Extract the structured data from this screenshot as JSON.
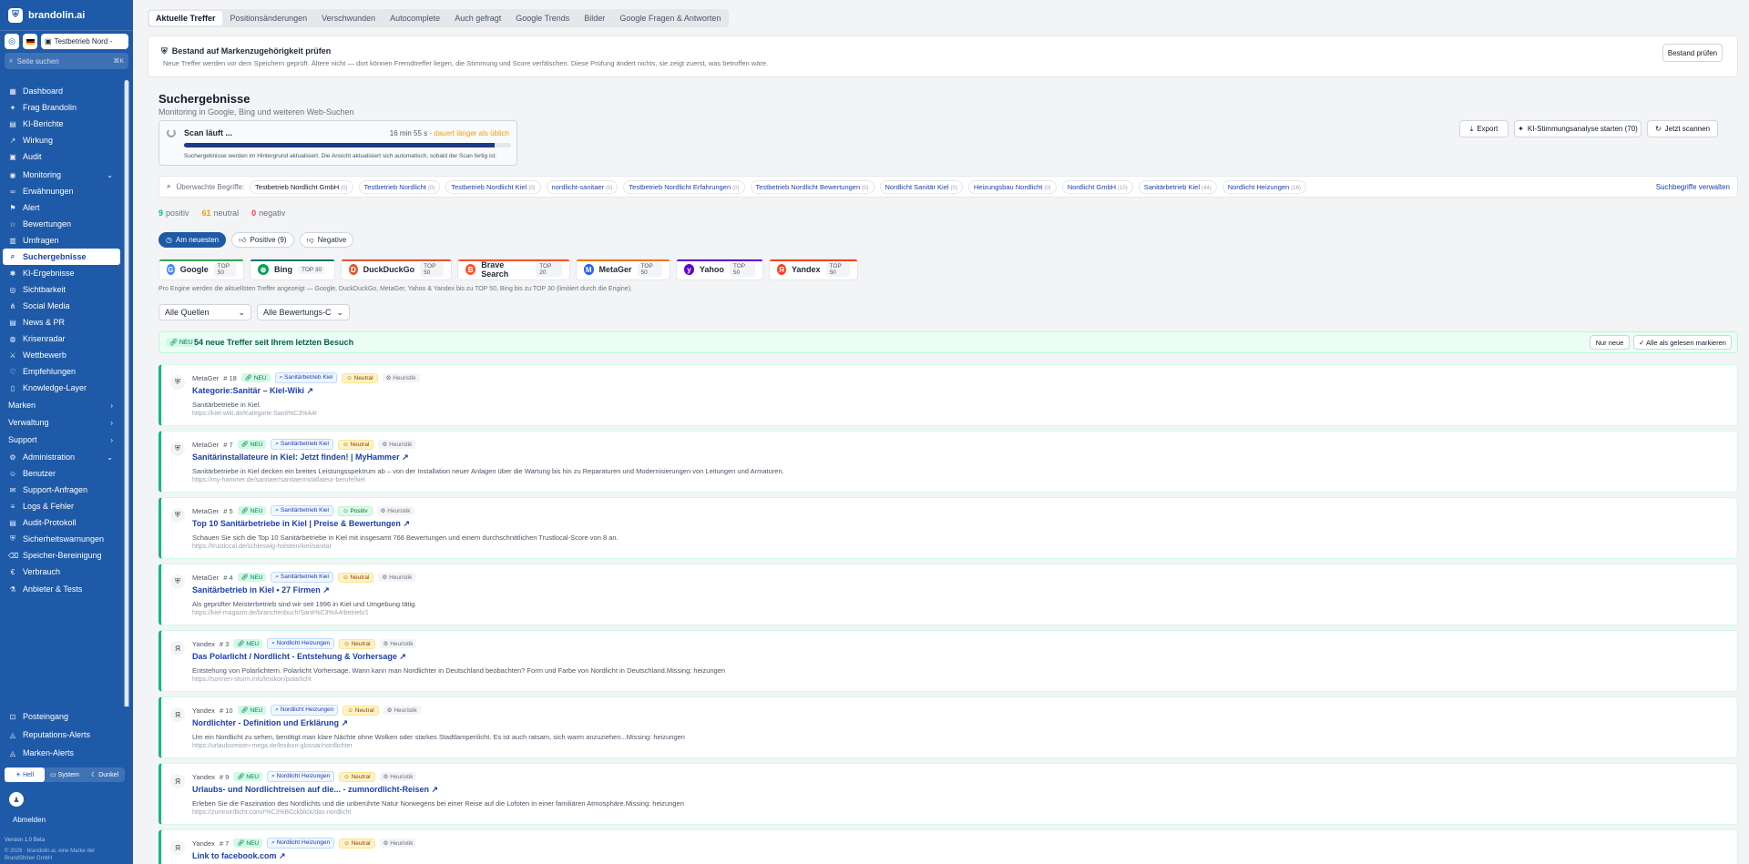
{
  "brand": {
    "name": "brandolin.ai"
  },
  "context": {
    "company": "Testbetrieb Nord -"
  },
  "search": {
    "placeholder": "Seite suchen",
    "shortcut": "⌘K"
  },
  "nav": {
    "items": [
      {
        "label": "Dashboard",
        "icon": "dashboard-icon"
      },
      {
        "label": "Frag Brandolin",
        "icon": "sparkle-icon"
      },
      {
        "label": "KI-Berichte",
        "icon": "report-icon"
      },
      {
        "label": "Wirkung",
        "icon": "trend-icon"
      },
      {
        "label": "Audit",
        "icon": "audit-icon"
      },
      {
        "label": "Monitoring",
        "icon": "monitor-icon",
        "chevron": "down"
      },
      {
        "label": "Erwähnungen",
        "icon": "link-icon"
      },
      {
        "label": "Alert",
        "icon": "alert-icon"
      },
      {
        "label": "Bewertungen",
        "icon": "star-icon"
      },
      {
        "label": "Umfragen",
        "icon": "survey-icon"
      },
      {
        "label": "Suchergebnisse",
        "icon": "search-icon",
        "active": true
      },
      {
        "label": "KI-Ergebnisse",
        "icon": "ai-icon"
      },
      {
        "label": "Sichtbarkeit",
        "icon": "eye-icon"
      },
      {
        "label": "Social Media",
        "icon": "share-icon"
      },
      {
        "label": "News & PR",
        "icon": "news-icon"
      },
      {
        "label": "Krisenradar",
        "icon": "radar-icon"
      },
      {
        "label": "Wettbewerb",
        "icon": "compete-icon"
      },
      {
        "label": "Empfehlungen",
        "icon": "recommend-icon"
      },
      {
        "label": "Knowledge-Layer",
        "icon": "book-icon"
      },
      {
        "label": "Marken",
        "icon": "",
        "chevron": "right"
      },
      {
        "label": "Verwaltung",
        "icon": "",
        "chevron": "right"
      },
      {
        "label": "Support",
        "icon": "",
        "chevron": "right"
      },
      {
        "label": "Administration",
        "icon": "admin-icon",
        "chevron": "down"
      },
      {
        "label": "Benutzer",
        "icon": "user-icon"
      },
      {
        "label": "Support-Anfragen",
        "icon": "chat-icon"
      },
      {
        "label": "Logs & Fehler",
        "icon": "log-icon"
      },
      {
        "label": "Audit-Protokoll",
        "icon": "protocol-icon"
      },
      {
        "label": "Sicherheitswarnungen",
        "icon": "shield-icon"
      },
      {
        "label": "Speicher-Bereinigung",
        "icon": "trash-icon"
      },
      {
        "label": "Verbrauch",
        "icon": "euro-icon"
      },
      {
        "label": "Anbieter & Tests",
        "icon": "test-icon"
      }
    ]
  },
  "nav_footer": {
    "items": [
      {
        "label": "Posteingang",
        "icon": "inbox-icon"
      },
      {
        "label": "Reputations-Alerts",
        "icon": "bell-icon"
      },
      {
        "label": "Marken-Alerts",
        "icon": "bell-icon"
      }
    ]
  },
  "theme": {
    "light": "Hell",
    "system": "System",
    "dark": "Dunkel"
  },
  "user": {
    "logout": "Abmelden"
  },
  "footer": {
    "version": "Version 1.0 Beta",
    "copyright": "© 2026 · brandolin.ai, eine Marke der BrandShiner GmbH"
  },
  "tabs": [
    "Aktuelle Treffer",
    "Positionsänderungen",
    "Verschwunden",
    "Autocomplete",
    "Auch gefragt",
    "Google Trends",
    "Bilder",
    "Google Fragen & Antworten"
  ],
  "banner": {
    "title": "Bestand auf Markenzugehörigkeit prüfen",
    "desc": "Neue Treffer werden vor dem Speichern geprüft. Ältere nicht — dort können Fremdtreffer liegen, die Stimmung und Score verfälschen. Diese Prüfung ändert nichts, sie zeigt zuerst, was betroffen wäre.",
    "button": "Bestand prüfen"
  },
  "page": {
    "title": "Suchergebnisse",
    "subtitle": "Monitoring in Google, Bing und weiteren Web-Suchen"
  },
  "actions": {
    "export": "Export",
    "ai": "KI-Stimmungsanalyse starten (70)",
    "scan": "Jetzt scannen"
  },
  "scan": {
    "title": "Scan läuft ...",
    "time": "16 min 55 s ·",
    "warn": "dauert länger als üblich",
    "progress": 0.95,
    "note": "Suchergebnisse werden im Hintergrund aktualisiert. Die Ansicht aktualisiert sich automatisch, sobald der Scan fertig ist."
  },
  "terms": {
    "label": "Überwachte Begriffe:",
    "manage": "Suchbegriffe verwalten",
    "items": [
      {
        "name": "Testbetrieb Nordlicht GmbH",
        "count": "(0)"
      },
      {
        "name": "Testbetrieb Nordlicht",
        "count": "(0)"
      },
      {
        "name": "Testbetrieb Nordlicht Kiel",
        "count": "(0)"
      },
      {
        "name": "nordlicht-sanitaer",
        "count": "(0)"
      },
      {
        "name": "Testbetrieb Nordlicht Erfahrungen",
        "count": "(0)"
      },
      {
        "name": "Testbetrieb Nordlicht Bewertungen",
        "count": "(0)"
      },
      {
        "name": "Nordlicht Sanitär Kiel",
        "count": "(0)"
      },
      {
        "name": "Heizungsbau Nordlicht",
        "count": "(0)"
      },
      {
        "name": "Nordlicht GmbH",
        "count": "(10)"
      },
      {
        "name": "Sanitärbetrieb Kiel",
        "count": "(44)"
      },
      {
        "name": "Nordlicht Heizungen",
        "count": "(16)"
      }
    ]
  },
  "stats": {
    "pos": "9",
    "pos_label": "positiv",
    "neu": "61",
    "neu_label": "neutral",
    "neg": "0",
    "neg_label": "negativ"
  },
  "filters": [
    "Am neuesten",
    "Positive (9)",
    "Negative"
  ],
  "engines": [
    {
      "name": "Google",
      "top": "TOP 50",
      "color": "#4285f4",
      "glyph": "G",
      "line": "#34a853"
    },
    {
      "name": "Bing",
      "top": "TOP 30",
      "color": "#0f9d58",
      "glyph": "⊕",
      "line": "#0f766e"
    },
    {
      "name": "DuckDuckGo",
      "top": "TOP 50",
      "color": "#de5833",
      "glyph": "D",
      "line": "#de5833"
    },
    {
      "name": "Brave Search",
      "top": "TOP 20",
      "color": "#fb542b",
      "glyph": "B",
      "line": "#fb542b"
    },
    {
      "name": "MetaGer",
      "top": "TOP 50",
      "color": "#2563eb",
      "glyph": "M",
      "line": "#f97316"
    },
    {
      "name": "Yahoo",
      "top": "TOP 50",
      "color": "#6001d2",
      "glyph": "y",
      "line": "#6001d2"
    },
    {
      "name": "Yandex",
      "top": "TOP 50",
      "color": "#fc3f1d",
      "glyph": "Я",
      "line": "#fc3f1d"
    }
  ],
  "engine_note": "Pro Engine werden die aktuellsten Treffer angezeigt — Google, DuckDuckGo, MetaGer, Yahoo & Yandex bis zu TOP 50, Bing bis zu TOP 30 (limitiert durch die Engine).",
  "dropdowns": {
    "sources": "Alle Quellen",
    "ratings": "Alle Bewertungs-C"
  },
  "newbar": {
    "badge": "NEU",
    "text": "54 neue Treffer seit Ihrem letzten Besuch",
    "only_new": "Nur neue",
    "mark_all": "✓ Alle als gelesen markieren"
  },
  "results": [
    {
      "engine": "MetaGer",
      "rank": "# 18",
      "new": "NEU",
      "term": "Sanitärbetrieb Kiel",
      "sentiment": "Neutral",
      "method": "Heuristik",
      "title": "Kategorie:Sanitär – Kiel-Wiki",
      "desc": "Sanitärbetriebe in Kiel.",
      "url": "https://kiel-wiki.de/Kategorie:Sanit%C3%A4r"
    },
    {
      "engine": "MetaGer",
      "rank": "# 7",
      "new": "NEU",
      "term": "Sanitärbetrieb Kiel",
      "sentiment": "Neutral",
      "method": "Heuristik",
      "title": "Sanitärinstallateure in Kiel: Jetzt finden! | MyHammer",
      "desc": "Sanitärbetriebe in Kiel decken ein breites Leistungsspektrum ab – von der Installation neuer Anlagen über die Wartung bis hin zu Reparaturen und Modernisierungen von Leitungen und Armaturen.",
      "url": "https://my-hammer.de/sanitaer/sanitaerinstallateur-berufe/kiel"
    },
    {
      "engine": "MetaGer",
      "rank": "# 5",
      "new": "NEU",
      "term": "Sanitärbetrieb Kiel",
      "sentiment": "Positiv",
      "method": "Heuristik",
      "title": "Top 10 Sanitärbetriebe in Kiel | Preise & Bewertungen",
      "desc": "Schauen Sie sich die Top 10 Sanitärbetriebe in Kiel mit insgesamt 766 Bewertungen und einem durchschnittlichen Trustlocal-Score von 8 an.",
      "url": "https://trustlocal.de/schleswig-holstein/kiel/sanitar"
    },
    {
      "engine": "MetaGer",
      "rank": "# 4",
      "new": "NEU",
      "term": "Sanitärbetrieb Kiel",
      "sentiment": "Neutral",
      "method": "Heuristik",
      "title": "Sanitärbetrieb in Kiel • 27 Firmen",
      "desc": "Als geprüfter Meisterbetrieb sind wir seit 1996 in Kiel und Umgebung tätig.",
      "url": "https://kiel-magazin.de/branchenbuch/Sanit%C3%A4rbetrieb/1"
    },
    {
      "engine": "Yandex",
      "rank": "# 3",
      "new": "NEU",
      "term": "Nordlicht Heizungen",
      "sentiment": "Neutral",
      "method": "Heuristik",
      "title": "Das Polarlicht / Nordlicht - Entstehung & Vorhersage",
      "desc": "Entstehung von Polarlichtern. Polarlicht Vorhersage. Wann kann man Nordlichter in Deutschland beobachten? Form und Farbe von Nordlicht in Deutschland.Missing: heizungen",
      "url": "https://sonnen-sturm.info/lexikon/polarlicht"
    },
    {
      "engine": "Yandex",
      "rank": "# 10",
      "new": "NEU",
      "term": "Nordlicht Heizungen",
      "sentiment": "Neutral",
      "method": "Heuristik",
      "title": "Nordlichter - Definition und Erklärung",
      "desc": "Um ein Nordlicht zu sehen, benötigt man klare Nächte ohne Wolken oder starkes Stadtlampenlicht. Es ist auch ratsam, sich warm anzuziehen...Missing: heizungen",
      "url": "https://urlaubsreisen-mega.de/lexikon-glossar/nordlichter"
    },
    {
      "engine": "Yandex",
      "rank": "# 9",
      "new": "NEU",
      "term": "Nordlicht Heizungen",
      "sentiment": "Neutral",
      "method": "Heuristik",
      "title": "Urlaubs- und Nordlichtreisen auf die... - zumnordlicht-Reisen",
      "desc": "Erleben Sie die Faszination des Nordlichts und die unberührte Natur Norwegens bei einer Reise auf die Lofoten in einer familiären Atmosphäre.Missing: heizungen",
      "url": "https://zumnordlicht.com/r%C3%BCckblick/das-nordlicht"
    },
    {
      "engine": "Yandex",
      "rank": "# 7",
      "new": "NEU",
      "term": "Nordlicht Heizungen",
      "sentiment": "Neutral",
      "method": "Heuristik",
      "title": "Link to facebook.com",
      "desc": "",
      "url": ""
    }
  ]
}
